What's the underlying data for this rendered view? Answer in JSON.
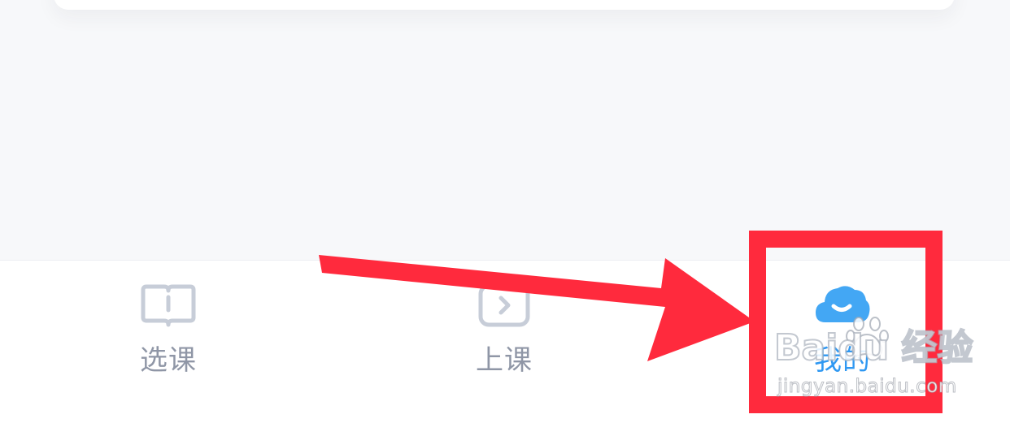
{
  "tabbar": {
    "tabs": [
      {
        "label": "选课",
        "icon": "course-book-icon",
        "active": false
      },
      {
        "label": "上课",
        "icon": "play-class-icon",
        "active": false
      },
      {
        "label": "我的",
        "icon": "cloud-smile-icon",
        "active": true
      }
    ]
  },
  "watermark": {
    "brand": "Baidu 经验",
    "url": "jingyan.baidu.com"
  },
  "colors": {
    "page_background": "#f7f8fa",
    "inactive_tab": "#8f96a6",
    "active_tab": "#2f98f2",
    "annotation_red": "#ff2a3d"
  }
}
